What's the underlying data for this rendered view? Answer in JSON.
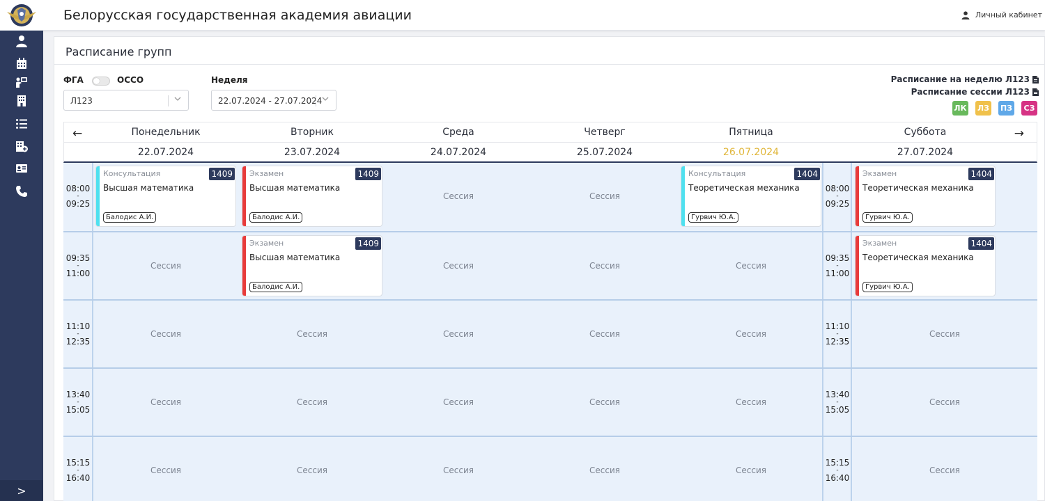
{
  "header": {
    "title": "Белорусская государственная академия авиации",
    "account_label": "Личный кабинет"
  },
  "sidebar": {
    "items": [
      {
        "icon": "user-icon"
      },
      {
        "icon": "calendar-icon"
      },
      {
        "icon": "teacher-icon"
      },
      {
        "icon": "building-icon"
      },
      {
        "icon": "list-icon"
      },
      {
        "icon": "building-plus-icon"
      },
      {
        "icon": "id-card-icon"
      },
      {
        "icon": "phone-icon"
      }
    ],
    "toggle_label": ">"
  },
  "page": {
    "title": "Расписание групп"
  },
  "filters": {
    "switch_left": "ФГА",
    "switch_right": "ОССО",
    "group_value": "Л123",
    "week_label": "Неделя",
    "week_value": "22.07.2024 - 27.07.2024"
  },
  "links": {
    "week_schedule": "Расписание на неделю Л123",
    "session_schedule": "Расписание сессии Л123"
  },
  "legend": [
    {
      "label": "ЛК",
      "color": "#68b95c"
    },
    {
      "label": "ЛЗ",
      "color": "#f0c14b"
    },
    {
      "label": "ПЗ",
      "color": "#5fa8e8"
    },
    {
      "label": "СЗ",
      "color": "#d63384"
    }
  ],
  "nav": {
    "prev": "←",
    "next": "→"
  },
  "days": [
    {
      "name": "Понедельник",
      "date": "22.07.2024",
      "today": false
    },
    {
      "name": "Вторник",
      "date": "23.07.2024",
      "today": false
    },
    {
      "name": "Среда",
      "date": "24.07.2024",
      "today": false
    },
    {
      "name": "Четверг",
      "date": "25.07.2024",
      "today": false
    },
    {
      "name": "Пятница",
      "date": "26.07.2024",
      "today": true
    },
    {
      "name": "Суббота",
      "date": "27.07.2024",
      "today": false
    }
  ],
  "slots": [
    {
      "start": "08:00",
      "end": "09:25"
    },
    {
      "start": "09:35",
      "end": "11:00"
    },
    {
      "start": "11:10",
      "end": "12:35"
    },
    {
      "start": "13:40",
      "end": "15:05"
    },
    {
      "start": "15:15",
      "end": "16:40"
    }
  ],
  "session_label": "Сессия",
  "dash": "-",
  "cards": [
    {
      "slot": 0,
      "day": 0,
      "type": "Консультация",
      "room": "1409",
      "subject": "Высшая математика",
      "teacher": "Балодис А.И.",
      "color": "#4fe0ef"
    },
    {
      "slot": 0,
      "day": 1,
      "type": "Экзамен",
      "room": "1409",
      "subject": "Высшая математика",
      "teacher": "Балодис А.И.",
      "color": "#e83b3b"
    },
    {
      "slot": 0,
      "day": 4,
      "type": "Консультация",
      "room": "1404",
      "subject": "Теоретическая механика",
      "teacher": "Гурвич Ю.А.",
      "color": "#4fe0ef"
    },
    {
      "slot": 0,
      "day": 5,
      "type": "Экзамен",
      "room": "1404",
      "subject": "Теоретическая механика",
      "teacher": "Гурвич Ю.А.",
      "color": "#e83b3b"
    },
    {
      "slot": 1,
      "day": 1,
      "type": "Экзамен",
      "room": "1409",
      "subject": "Высшая математика",
      "teacher": "Балодис А.И.",
      "color": "#e83b3b"
    },
    {
      "slot": 1,
      "day": 5,
      "type": "Экзамен",
      "room": "1404",
      "subject": "Теоретическая механика",
      "teacher": "Гурвич Ю.А.",
      "color": "#e83b3b"
    }
  ]
}
